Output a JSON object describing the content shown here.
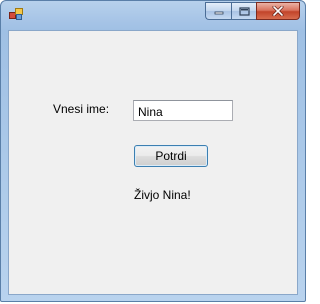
{
  "window": {
    "title": "",
    "icon": "winforms-app-icon",
    "caption_buttons": [
      "minimize-icon",
      "maximize-icon",
      "close-icon"
    ]
  },
  "form": {
    "name_label": "Vnesi ime:",
    "name_input_value": "Nina",
    "confirm_button_label": "Potrdi",
    "greeting_text": "Živjo Nina!"
  },
  "colors": {
    "frame_accent": "#a5c3e6",
    "client_background": "#f0f0f0",
    "close_button": "#c2442a",
    "button_focus_border": "#3c7fb1"
  }
}
